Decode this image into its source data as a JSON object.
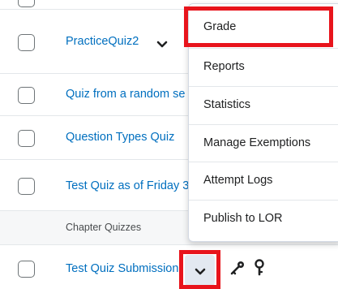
{
  "list": {
    "items": [
      {
        "title": "PracticeQuiz2"
      },
      {
        "title": "Quiz from a random se"
      },
      {
        "title": "Question Types Quiz"
      },
      {
        "title": "Test Quiz as of Friday 3"
      }
    ],
    "section_label": "Chapter Quizzes",
    "last_item": {
      "title": "Test Quiz Submission"
    }
  },
  "context_menu": {
    "items": [
      {
        "label": "Grade"
      },
      {
        "label": "Reports"
      },
      {
        "label": "Statistics"
      },
      {
        "label": "Manage Exemptions"
      },
      {
        "label": "Attempt Logs"
      },
      {
        "label": "Publish to LOR"
      }
    ]
  },
  "icons": {
    "row_menu": "chevron-down-icon",
    "unlock": "key-icon",
    "restrictions": "key-small-icon"
  },
  "colors": {
    "link": "#006fbf",
    "highlight": "#e8141c",
    "text": "#202122"
  }
}
